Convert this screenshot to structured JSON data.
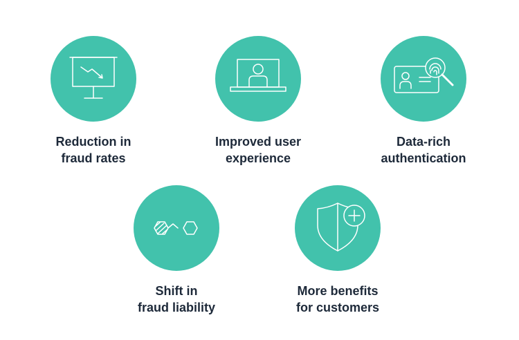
{
  "accent_color": "#42c2ac",
  "text_color": "#1d2939",
  "icon_color": "#ffffff",
  "benefits": [
    {
      "icon": "presentation-chart-down-icon",
      "line1": "Reduction in",
      "line2": "fraud rates"
    },
    {
      "icon": "laptop-user-icon",
      "line1": "Improved user",
      "line2": "experience"
    },
    {
      "icon": "id-card-fingerprint-icon",
      "line1": "Data-rich",
      "line2": "authentication"
    },
    {
      "icon": "hexagons-shift-icon",
      "line1": "Shift in",
      "line2": "fraud liability"
    },
    {
      "icon": "shield-plus-icon",
      "line1": "More benefits",
      "line2": "for customers"
    }
  ]
}
